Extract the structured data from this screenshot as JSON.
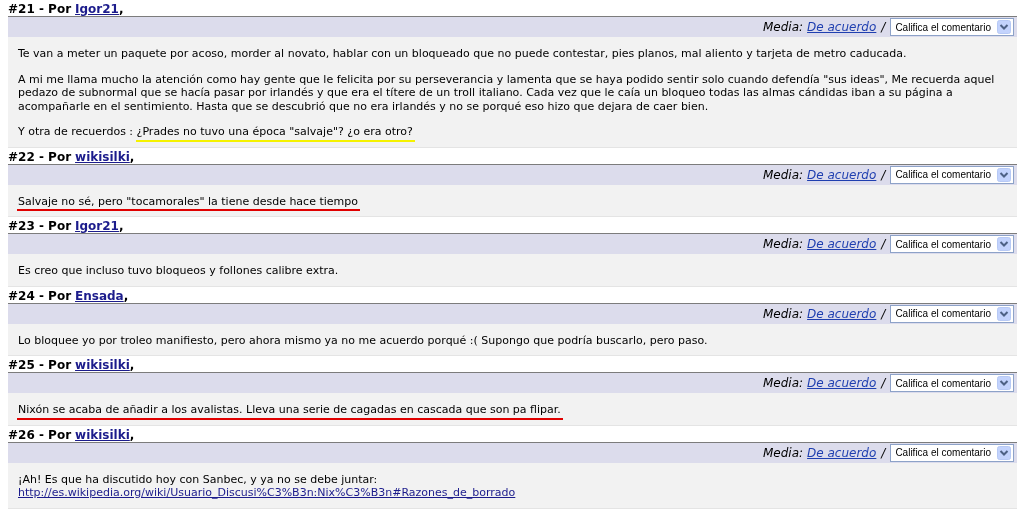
{
  "comments": [
    {
      "number": "#21",
      "dash": "-",
      "comma": ",",
      "by": "Por",
      "author": "Igor21",
      "rating_label": "Media:",
      "rating": "De acuerdo",
      "separator": "/",
      "dropdown": "Califica el comentario",
      "paragraphs": [
        {
          "text": "Te van a meter un paquete por acoso, morder al novato, hablar con un bloqueado que no puede contestar, pies planos, mal aliento y tarjeta de metro caducada."
        },
        {
          "text": "A mi me llama mucho la atención como hay gente que le felicita por su perseverancia y lamenta que se haya podido sentir solo cuando defendía \"sus ideas\", Me recuerda aquel pedazo de subnormal que se hacía pasar por irlandés y que era el títere de un troll italiano. Cada vez que le caía un bloqueo todas las almas cándidas iban a su página a acompañarle en el sentimiento. Hasta que se descubrió que no era irlandés y no se porqué eso hizo que dejara de caer bien."
        },
        {
          "text": "Y otra de recuerdos : ",
          "marked": "¿Prades no tuvo una época \"salvaje\"? ¿o era otro?",
          "color": "#f5f200"
        }
      ]
    },
    {
      "number": "#22",
      "dash": "-",
      "comma": ",",
      "by": "Por",
      "author": "wikisilki",
      "rating_label": "Media:",
      "rating": "De acuerdo",
      "separator": "/",
      "dropdown": "Califica el comentario",
      "paragraphs": [
        {
          "marked": "Salvaje no sé, pero \"tocamorales\" la tiene desde hace tiempo ",
          "color": "#e00000"
        }
      ]
    },
    {
      "number": "#23",
      "dash": "-",
      "comma": ",",
      "by": "Por",
      "author": "Igor21",
      "rating_label": "Media:",
      "rating": "De acuerdo",
      "separator": "/",
      "dropdown": "Califica el comentario",
      "paragraphs": [
        {
          "text": "Es creo que incluso tuvo bloqueos y follones calibre extra."
        }
      ]
    },
    {
      "number": "#24",
      "dash": "-",
      "comma": ",",
      "by": "Por",
      "author": "Ensada",
      "rating_label": "Media:",
      "rating": "De acuerdo",
      "separator": "/",
      "dropdown": "Califica el comentario",
      "paragraphs": [
        {
          "text": "Lo bloquee yo por troleo manifiesto, pero ahora mismo ya no me acuerdo porqué :( Supongo que podría buscarlo, pero paso."
        }
      ]
    },
    {
      "number": "#25",
      "dash": "-",
      "comma": ",",
      "by": "Por",
      "author": "wikisilki",
      "rating_label": "Media:",
      "rating": "De acuerdo",
      "separator": "/",
      "dropdown": "Califica el comentario",
      "paragraphs": [
        {
          "marked": "Nixón se acaba de añadir a los avalistas. Lleva una serie de cagadas en cascada que son pa flipar.",
          "color": "#e00000"
        }
      ]
    },
    {
      "number": "#26",
      "dash": "-",
      "comma": ",",
      "by": "Por",
      "author": "wikisilki",
      "rating_label": "Media:",
      "rating": "De acuerdo",
      "separator": "/",
      "dropdown": "Califica el comentario",
      "paragraphs": [
        {
          "text": "¡Ah! Es que ha discutido hoy con Sanbec, y ya no se debe juntar:",
          "link": "http://es.wikipedia.org/wiki/Usuario_Discusi%C3%B3n:Nix%C3%B3n#Razones_de_borrado"
        }
      ]
    }
  ]
}
